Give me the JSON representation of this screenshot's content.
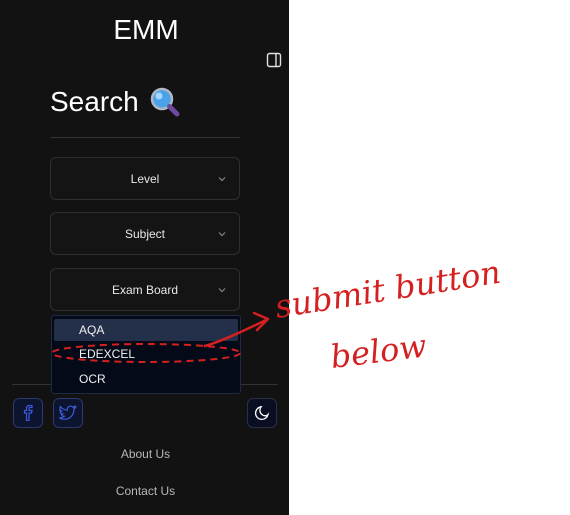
{
  "app": {
    "brand": "EMM",
    "toggle_icon": "sidebar-toggle-icon"
  },
  "search": {
    "title": "Search",
    "icon": "magnifying-glass-emoji-icon"
  },
  "filters": [
    {
      "label": "Level",
      "icon": "chevron-down-icon"
    },
    {
      "label": "Subject",
      "icon": "chevron-down-icon"
    },
    {
      "label": "Exam Board",
      "icon": "chevron-down-icon"
    }
  ],
  "exam_board_options": [
    "AQA",
    "EDEXCEL",
    "OCR"
  ],
  "footer": {
    "social": [
      {
        "name": "facebook",
        "icon": "facebook-icon"
      },
      {
        "name": "twitter",
        "icon": "twitter-icon"
      }
    ],
    "theme_icon": "moon-icon",
    "links": [
      "About Us",
      "Contact Us"
    ]
  },
  "annotation": {
    "line1": "submit button",
    "line2": "below",
    "color": "#d42020"
  },
  "colors": {
    "sidebar_bg": "#121212",
    "accent_blue": "#3b5bdb",
    "dropdown_bg": "#050a18",
    "dropdown_active": "#243049"
  }
}
